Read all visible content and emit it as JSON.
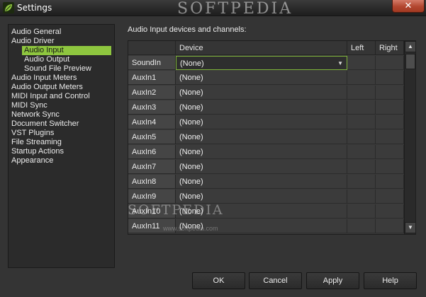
{
  "window": {
    "title": "Settings",
    "watermark": "SOFTPEDIA",
    "close_glyph": "✕",
    "app_icon": "green-leaf-icon",
    "accent_color": "#8ec63f"
  },
  "nav": {
    "items": [
      {
        "label": "Audio General",
        "level": 0,
        "selected": false
      },
      {
        "label": "Audio Driver",
        "level": 0,
        "selected": false
      },
      {
        "label": "Audio Input",
        "level": 1,
        "selected": true
      },
      {
        "label": "Audio Output",
        "level": 1,
        "selected": false
      },
      {
        "label": "Sound File Preview",
        "level": 1,
        "selected": false
      },
      {
        "label": "Audio Input Meters",
        "level": 0,
        "selected": false
      },
      {
        "label": "Audio Output Meters",
        "level": 0,
        "selected": false
      },
      {
        "label": "MIDI Input and Control",
        "level": 0,
        "selected": false
      },
      {
        "label": "MIDI Sync",
        "level": 0,
        "selected": false
      },
      {
        "label": "Network Sync",
        "level": 0,
        "selected": false
      },
      {
        "label": "Document Switcher",
        "level": 0,
        "selected": false
      },
      {
        "label": "VST Plugins",
        "level": 0,
        "selected": false
      },
      {
        "label": "File Streaming",
        "level": 0,
        "selected": false
      },
      {
        "label": "Startup Actions",
        "level": 0,
        "selected": false
      },
      {
        "label": "Appearance",
        "level": 0,
        "selected": false
      }
    ]
  },
  "main": {
    "section_label": "Audio Input devices and channels:",
    "table": {
      "columns": [
        "",
        "Device",
        "Left",
        "Right"
      ],
      "rows": [
        {
          "name": "SoundIn",
          "device": "(None)",
          "dropdown": true
        },
        {
          "name": "AuxIn1",
          "device": "(None)",
          "dropdown": false
        },
        {
          "name": "AuxIn2",
          "device": "(None)",
          "dropdown": false
        },
        {
          "name": "AuxIn3",
          "device": "(None)",
          "dropdown": false
        },
        {
          "name": "AuxIn4",
          "device": "(None)",
          "dropdown": false
        },
        {
          "name": "AuxIn5",
          "device": "(None)",
          "dropdown": false
        },
        {
          "name": "AuxIn6",
          "device": "(None)",
          "dropdown": false
        },
        {
          "name": "AuxIn7",
          "device": "(None)",
          "dropdown": false
        },
        {
          "name": "AuxIn8",
          "device": "(None)",
          "dropdown": false
        },
        {
          "name": "AuxIn9",
          "device": "(None)",
          "dropdown": false
        },
        {
          "name": "AuxIn10",
          "device": "(None)",
          "dropdown": false
        },
        {
          "name": "AuxIn11",
          "device": "(None)",
          "dropdown": false
        }
      ],
      "scroll_up_glyph": "▲",
      "scroll_down_glyph": "▼",
      "dropdown_glyph": "▼"
    },
    "overlay_watermark": "SOFTPEDIA",
    "overlay_small": "www.softpedia.com"
  },
  "buttons": {
    "ok": "OK",
    "cancel": "Cancel",
    "apply": "Apply",
    "help": "Help"
  }
}
